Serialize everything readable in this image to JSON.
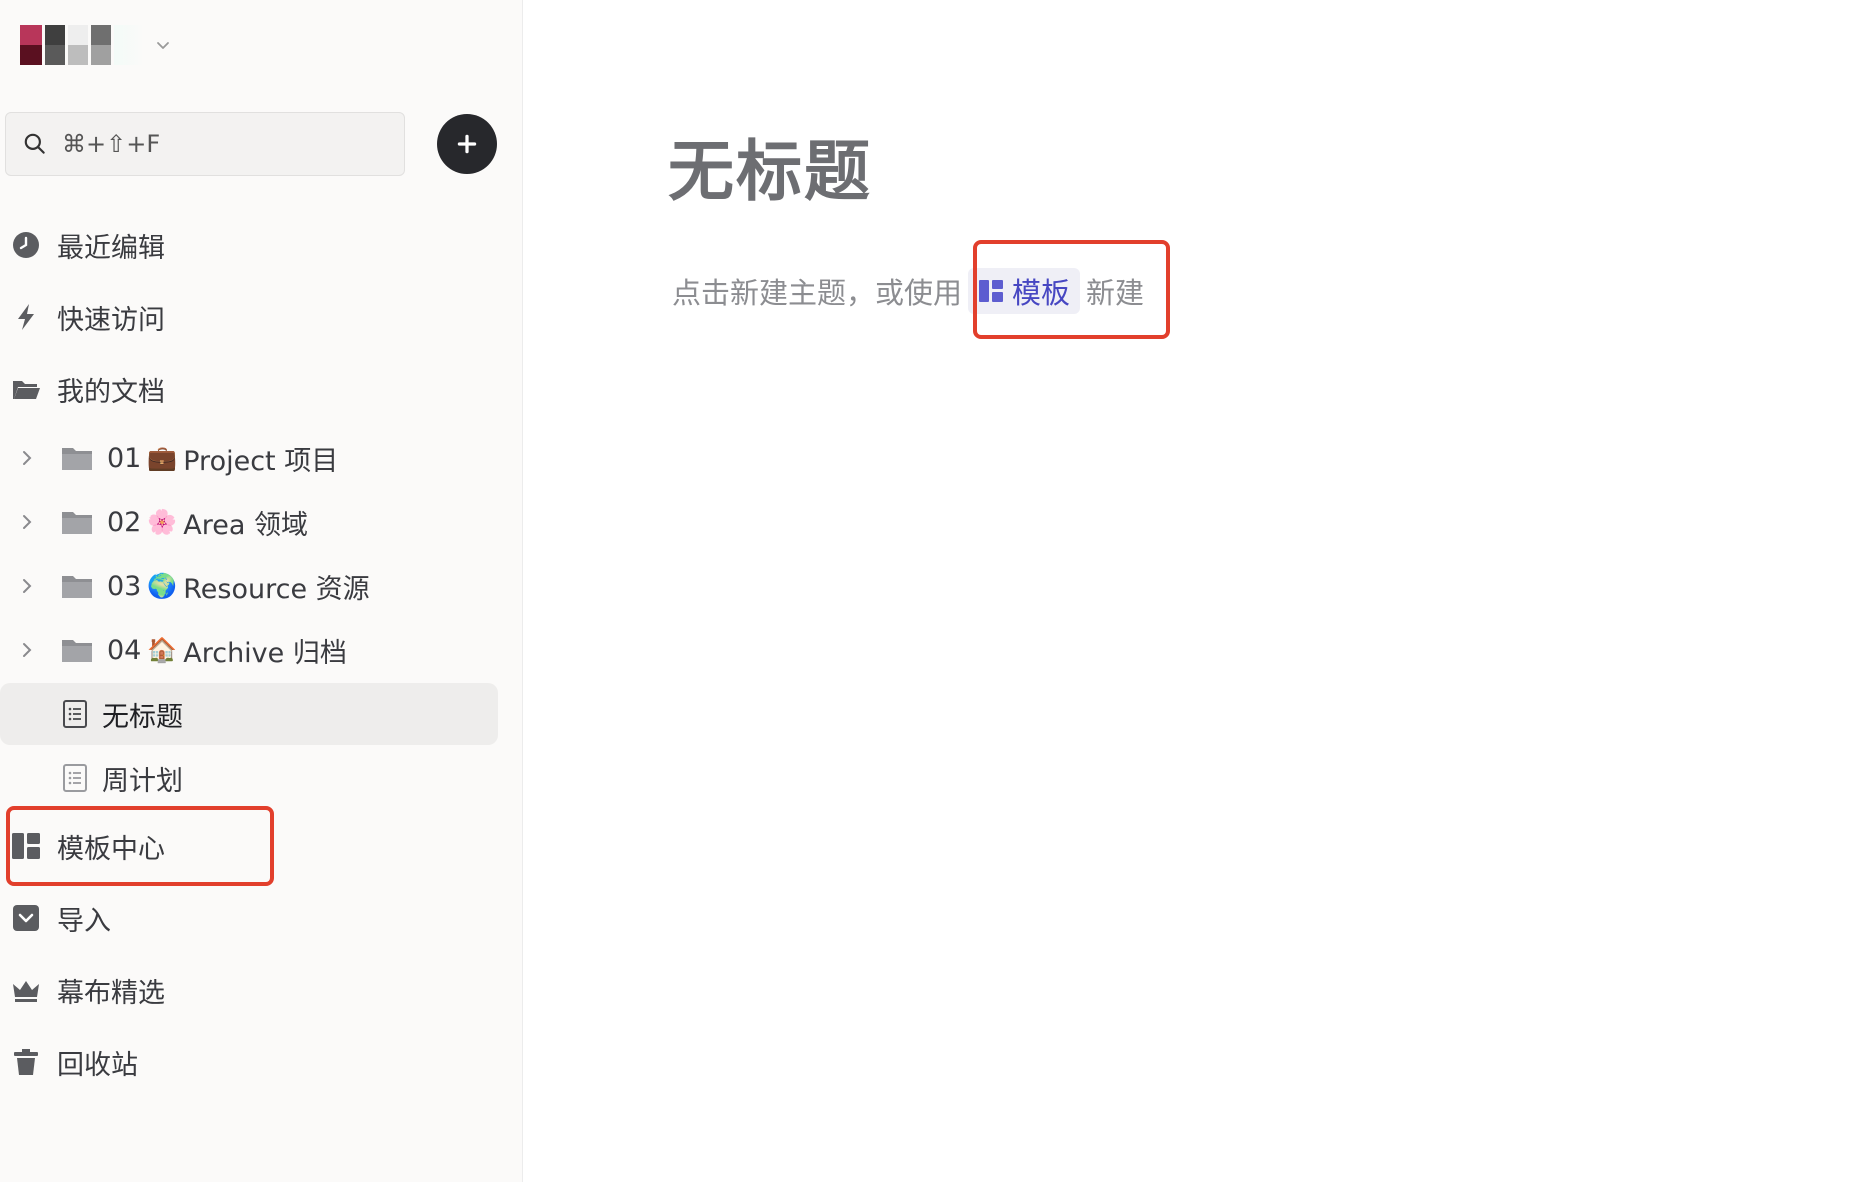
{
  "search": {
    "placeholder": "⌘+⇧+F"
  },
  "nav": {
    "recent": "最近编辑",
    "quick": "快速访问",
    "mydocs": "我的文档",
    "templates": "模板中心",
    "import": "导入",
    "featured": "幕布精选",
    "trash": "回收站"
  },
  "tree": [
    {
      "num": "01",
      "emoji": "💼",
      "name": "Project 项目"
    },
    {
      "num": "02",
      "emoji": "🌸",
      "name": "Area 领域"
    },
    {
      "num": "03",
      "emoji": "🌍",
      "name": "Resource 资源"
    },
    {
      "num": "04",
      "emoji": "🏠",
      "name": "Archive 归档"
    }
  ],
  "docs": [
    {
      "name": "无标题"
    },
    {
      "name": "周计划"
    }
  ],
  "main": {
    "title": "无标题",
    "hint_before": "点击新建主题，或使用",
    "hint_chip": "模板",
    "hint_after": "新建"
  }
}
